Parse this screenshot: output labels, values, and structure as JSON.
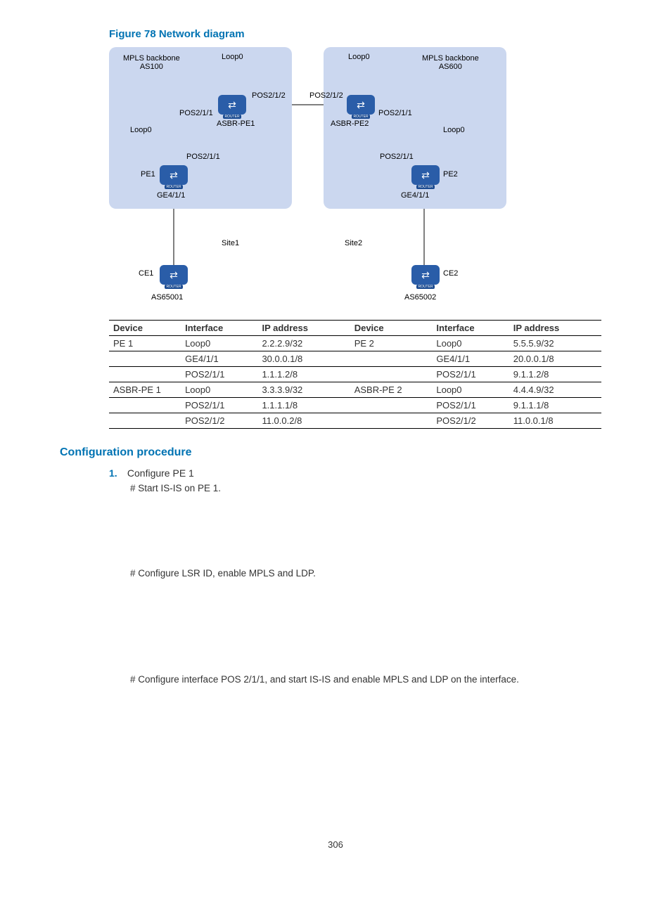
{
  "figure_title": "Figure 78 Network diagram",
  "diagram": {
    "as_left": "MPLS backbone\nAS100",
    "as_right": "MPLS backbone\nAS600",
    "loop0": "Loop0",
    "pos212": "POS2/1/2",
    "pos211": "POS2/1/1",
    "ge411": "GE4/1/1",
    "asbr_pe1": "ASBR-PE1",
    "asbr_pe2": "ASBR-PE2",
    "pe1": "PE1",
    "pe2": "PE2",
    "ce1": "CE1",
    "ce2": "CE2",
    "site1": "Site1",
    "site2": "Site2",
    "as65001": "AS65001",
    "as65002": "AS65002",
    "router_cap": "ROUTER"
  },
  "table": {
    "headers": [
      "Device",
      "Interface",
      "IP address",
      "Device",
      "Interface",
      "IP address"
    ],
    "rows": [
      [
        "PE 1",
        "Loop0",
        "2.2.2.9/32",
        "PE 2",
        "Loop0",
        "5.5.5.9/32"
      ],
      [
        "",
        "GE4/1/1",
        "30.0.0.1/8",
        "",
        "GE4/1/1",
        "20.0.0.1/8"
      ],
      [
        "",
        "POS2/1/1",
        "1.1.1.2/8",
        "",
        "POS2/1/1",
        "9.1.1.2/8"
      ],
      [
        "ASBR-PE 1",
        "Loop0",
        "3.3.3.9/32",
        "ASBR-PE 2",
        "Loop0",
        "4.4.4.9/32"
      ],
      [
        "",
        "POS2/1/1",
        "1.1.1.1/8",
        "",
        "POS2/1/1",
        "9.1.1.1/8"
      ],
      [
        "",
        "POS2/1/2",
        "11.0.0.2/8",
        "",
        "POS2/1/2",
        "11.0.0.1/8"
      ]
    ]
  },
  "section_title": "Configuration procedure",
  "proc": {
    "num": "1.",
    "step": "Configure PE 1",
    "sub1": "# Start IS-IS on PE 1.",
    "sub2": "# Configure LSR ID, enable MPLS and LDP.",
    "sub3": "# Configure interface POS 2/1/1, and start IS-IS and enable MPLS and LDP on the interface."
  },
  "page_number": "306"
}
